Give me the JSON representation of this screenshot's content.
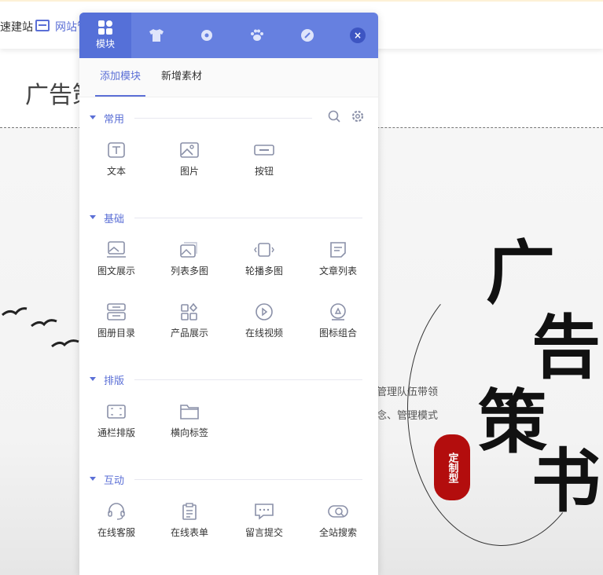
{
  "topbar": {
    "item1": "速建站",
    "item2": "网站管"
  },
  "page": {
    "title": "广告策",
    "banner_line1": "明气的管理队伍带领",
    "banner_line2": "经营理念、管理模式",
    "seal": "定制型",
    "calligraphy": [
      "广",
      "告",
      "策",
      "书"
    ]
  },
  "panel": {
    "header_tabs": [
      {
        "label": "模块",
        "icon": "grid-icon"
      },
      {
        "icon": "shirt-icon"
      },
      {
        "icon": "flower-icon"
      },
      {
        "icon": "paw-icon"
      },
      {
        "icon": "link-icon"
      }
    ],
    "close_icon": "×",
    "subtabs": [
      "添加模块",
      "新增素材"
    ],
    "sections": [
      {
        "name": "常用",
        "items": [
          {
            "label": "文本",
            "icon": "text-icon"
          },
          {
            "label": "图片",
            "icon": "image-icon"
          },
          {
            "label": "按钮",
            "icon": "button-icon"
          }
        ]
      },
      {
        "name": "基础",
        "items": [
          {
            "label": "图文展示",
            "icon": "image-text-icon"
          },
          {
            "label": "列表多图",
            "icon": "multi-image-icon"
          },
          {
            "label": "轮播多图",
            "icon": "carousel-icon"
          },
          {
            "label": "文章列表",
            "icon": "article-icon"
          },
          {
            "label": "图册目录",
            "icon": "album-icon"
          },
          {
            "label": "产品展示",
            "icon": "product-icon"
          },
          {
            "label": "在线视频",
            "icon": "video-icon"
          },
          {
            "label": "图标组合",
            "icon": "icon-group-icon"
          }
        ]
      },
      {
        "name": "排版",
        "items": [
          {
            "label": "通栏排版",
            "icon": "fullwidth-icon"
          },
          {
            "label": "横向标签",
            "icon": "folder-tab-icon"
          }
        ]
      },
      {
        "name": "互动",
        "items": [
          {
            "label": "在线客服",
            "icon": "headset-icon"
          },
          {
            "label": "在线表单",
            "icon": "form-icon"
          },
          {
            "label": "留言提交",
            "icon": "message-icon"
          },
          {
            "label": "全站搜索",
            "icon": "site-search-icon"
          }
        ]
      }
    ]
  }
}
